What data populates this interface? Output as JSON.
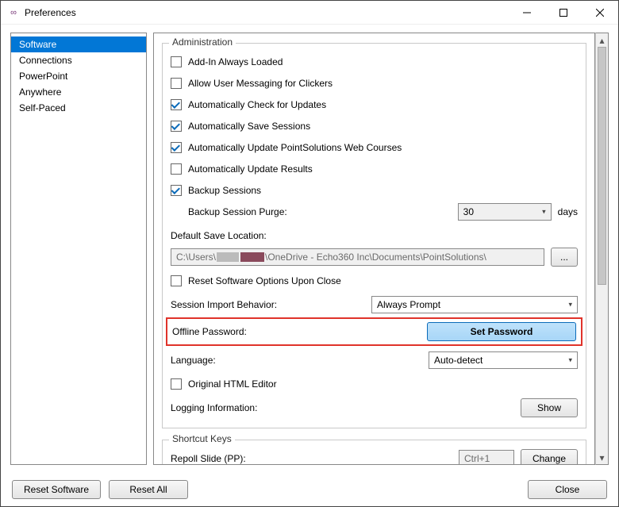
{
  "window": {
    "title": "Preferences"
  },
  "sidebar": {
    "items": [
      {
        "label": "Software"
      },
      {
        "label": "Connections"
      },
      {
        "label": "PowerPoint"
      },
      {
        "label": "Anywhere"
      },
      {
        "label": "Self-Paced"
      }
    ]
  },
  "admin": {
    "group_title": "Administration",
    "addin_loaded": {
      "label": "Add-In Always Loaded",
      "checked": false
    },
    "allow_user_msg": {
      "label": "Allow User Messaging for Clickers",
      "checked": false
    },
    "auto_update_check": {
      "label": "Automatically Check for Updates",
      "checked": true
    },
    "auto_save_sessions": {
      "label": "Automatically Save Sessions",
      "checked": true
    },
    "auto_update_web": {
      "label": "Automatically Update PointSolutions Web Courses",
      "checked": true
    },
    "auto_update_results": {
      "label": "Automatically Update Results",
      "checked": false
    },
    "backup_sessions": {
      "label": "Backup Sessions",
      "checked": true
    },
    "backup_purge": {
      "label": "Backup Session Purge:",
      "value": "30",
      "unit": "days"
    },
    "default_save": {
      "label": "Default Save Location:",
      "prefix": "C:\\Users\\",
      "suffix": "\\OneDrive - Echo360 Inc\\Documents\\PointSolutions\\",
      "browse": "..."
    },
    "reset_on_close": {
      "label": "Reset Software Options Upon Close",
      "checked": false
    },
    "import_behavior": {
      "label": "Session Import Behavior:",
      "value": "Always Prompt"
    },
    "offline_password": {
      "label": "Offline Password:",
      "button": "Set Password"
    },
    "language": {
      "label": "Language:",
      "value": "Auto-detect"
    },
    "original_html": {
      "label": "Original HTML Editor",
      "checked": false
    },
    "logging_info": {
      "label": "Logging Information:",
      "button": "Show"
    }
  },
  "shortcuts": {
    "group_title": "Shortcut Keys",
    "repoll": {
      "label": "Repoll Slide (PP):",
      "value": "Ctrl+1",
      "button": "Change"
    }
  },
  "footer": {
    "reset_software": "Reset Software",
    "reset_all": "Reset All",
    "close": "Close"
  }
}
